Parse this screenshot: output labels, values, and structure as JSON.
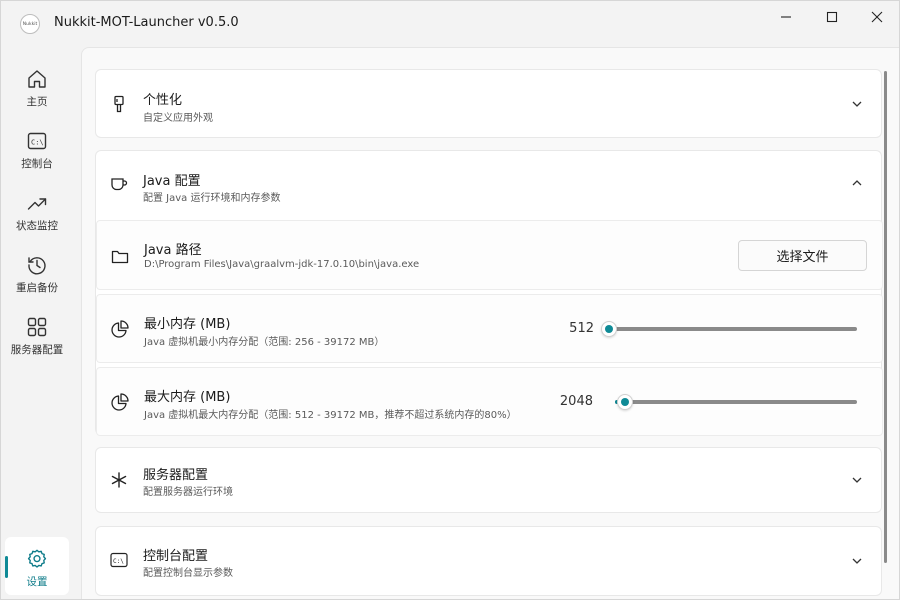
{
  "window": {
    "title": "Nukkit-MOT-Launcher v0.5.0",
    "logo_text": "Nukkit"
  },
  "sidebar": {
    "items": [
      {
        "label": "主页",
        "icon": "home-icon"
      },
      {
        "label": "控制台",
        "icon": "console-icon"
      },
      {
        "label": "状态监控",
        "icon": "trending-up-icon"
      },
      {
        "label": "重启备份",
        "icon": "history-icon"
      },
      {
        "label": "服务器配置",
        "icon": "grid-icon"
      }
    ],
    "settings": {
      "label": "设置",
      "icon": "gear-icon",
      "active": true
    }
  },
  "sections": {
    "personalize": {
      "title": "个性化",
      "subtitle": "自定义应用外观",
      "expanded": false,
      "icon": "brush-icon"
    },
    "java": {
      "title": "Java 配置",
      "subtitle": "配置 Java 运行环境和内存参数",
      "expanded": true,
      "icon": "cup-icon",
      "path": {
        "title": "Java 路径",
        "value": "D:\\Program Files\\Java\\graalvm-jdk-17.0.10\\bin\\java.exe",
        "button_label": "选择文件",
        "icon": "folder-icon"
      },
      "min_memory": {
        "title": "最小内存 (MB)",
        "subtitle": "Java 虚拟机最小内存分配（范围: 256 - 39172 MB）",
        "value": "512",
        "min": 256,
        "max": 39172,
        "current": 512,
        "icon": "pie-chart-icon"
      },
      "max_memory": {
        "title": "最大内存 (MB)",
        "subtitle": "Java 虚拟机最大内存分配（范围: 512 - 39172 MB，推荐不超过系统内存的80%）",
        "value": "2048",
        "min": 512,
        "max": 39172,
        "current": 2048,
        "icon": "pie-chart-icon"
      }
    },
    "server": {
      "title": "服务器配置",
      "subtitle": "配置服务器运行环境",
      "expanded": false,
      "icon": "asterisk-icon"
    },
    "console": {
      "title": "控制台配置",
      "subtitle": "配置控制台显示参数",
      "expanded": false,
      "icon": "console-icon"
    }
  },
  "colors": {
    "accent": "#0f8a96",
    "background": "#f3f3f3",
    "card": "#ffffff"
  }
}
